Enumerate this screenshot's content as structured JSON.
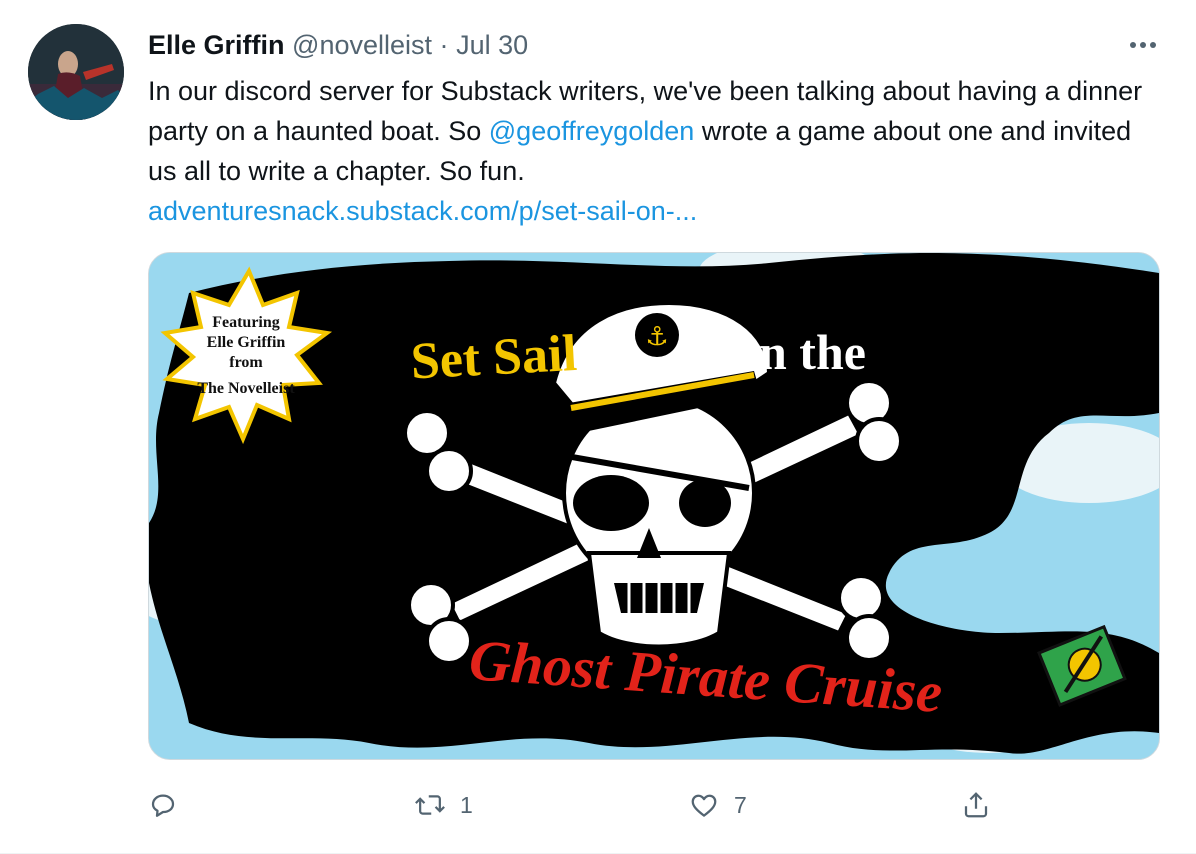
{
  "tweet": {
    "author_name": "Elle Griffin",
    "handle": "@novelleist",
    "separator": "·",
    "date": "Jul 30",
    "text_before": "In our discord server for Substack writers, we've been talking about having a dinner party on a haunted boat. So ",
    "mention": "@geoffreygolden",
    "text_after": " wrote a game about one and invited us all to write a chapter. So fun.",
    "link": "adventuresnack.substack.com/p/set-sail-on-...",
    "avatar_icon": "profile-photo"
  },
  "card": {
    "badge_line1": "Featuring",
    "badge_line2": "Elle Griffin",
    "badge_line3": "from",
    "badge_line4": "The Novelleist",
    "title_set_sail": "Set Sail",
    "title_on_the": "on the",
    "title_ghost": "Ghost Pirate Cruise",
    "sky_color": "#9ad8ef",
    "flag_color": "#000000",
    "title_yellow": "#f3c500",
    "title_red": "#e2231a"
  },
  "actions": {
    "reply_icon": "reply-icon",
    "reply_count": "",
    "retweet_icon": "retweet-icon",
    "retweet_count": "1",
    "like_icon": "heart-icon",
    "like_count": "7",
    "share_icon": "share-icon"
  },
  "colors": {
    "link": "#1b95e0",
    "muted": "#536471",
    "text": "#0f1419"
  }
}
